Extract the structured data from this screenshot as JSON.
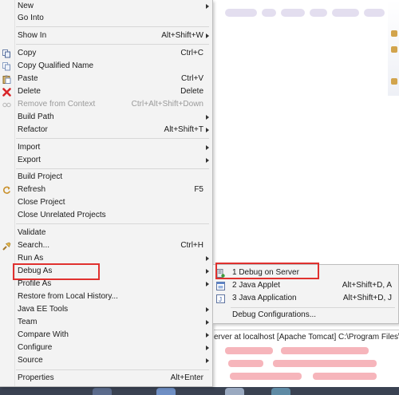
{
  "context_menu": {
    "items": [
      {
        "label": "New",
        "shortcut": "",
        "submenu": true,
        "icon": ""
      },
      {
        "label": "Go Into",
        "shortcut": "",
        "submenu": false,
        "icon": ""
      },
      {
        "label": "Show In",
        "shortcut": "Alt+Shift+W",
        "submenu": true,
        "icon": ""
      },
      {
        "label": "Copy",
        "shortcut": "Ctrl+C",
        "submenu": false,
        "icon": "copy-icon"
      },
      {
        "label": "Copy Qualified Name",
        "shortcut": "",
        "submenu": false,
        "icon": "copy-qualified-name-icon"
      },
      {
        "label": "Paste",
        "shortcut": "Ctrl+V",
        "submenu": false,
        "icon": "paste-icon"
      },
      {
        "label": "Delete",
        "shortcut": "Delete",
        "submenu": false,
        "icon": "delete-icon"
      },
      {
        "label": "Remove from Context",
        "shortcut": "Ctrl+Alt+Shift+Down",
        "submenu": false,
        "icon": "remove-from-context-icon",
        "disabled": true
      },
      {
        "label": "Build Path",
        "shortcut": "",
        "submenu": true,
        "icon": ""
      },
      {
        "label": "Refactor",
        "shortcut": "Alt+Shift+T",
        "submenu": true,
        "icon": ""
      },
      {
        "label": "Import",
        "shortcut": "",
        "submenu": true,
        "icon": ""
      },
      {
        "label": "Export",
        "shortcut": "",
        "submenu": true,
        "icon": ""
      },
      {
        "label": "Build Project",
        "shortcut": "",
        "submenu": false,
        "icon": ""
      },
      {
        "label": "Refresh",
        "shortcut": "F5",
        "submenu": false,
        "icon": "refresh-icon"
      },
      {
        "label": "Close Project",
        "shortcut": "",
        "submenu": false,
        "icon": ""
      },
      {
        "label": "Close Unrelated Projects",
        "shortcut": "",
        "submenu": false,
        "icon": ""
      },
      {
        "label": "Validate",
        "shortcut": "",
        "submenu": false,
        "icon": ""
      },
      {
        "label": "Search...",
        "shortcut": "Ctrl+H",
        "submenu": false,
        "icon": "search-icon"
      },
      {
        "label": "Run As",
        "shortcut": "",
        "submenu": true,
        "icon": ""
      },
      {
        "label": "Debug As",
        "shortcut": "",
        "submenu": true,
        "icon": ""
      },
      {
        "label": "Profile As",
        "shortcut": "",
        "submenu": true,
        "icon": ""
      },
      {
        "label": "Restore from Local History...",
        "shortcut": "",
        "submenu": false,
        "icon": ""
      },
      {
        "label": "Java EE Tools",
        "shortcut": "",
        "submenu": true,
        "icon": ""
      },
      {
        "label": "Team",
        "shortcut": "",
        "submenu": true,
        "icon": ""
      },
      {
        "label": "Compare With",
        "shortcut": "",
        "submenu": true,
        "icon": ""
      },
      {
        "label": "Configure",
        "shortcut": "",
        "submenu": true,
        "icon": ""
      },
      {
        "label": "Source",
        "shortcut": "",
        "submenu": true,
        "icon": ""
      },
      {
        "label": "Properties",
        "shortcut": "Alt+Enter",
        "submenu": false,
        "icon": ""
      }
    ]
  },
  "debug_submenu": {
    "items": [
      {
        "label": "1 Debug on Server",
        "shortcut": "",
        "icon": "debug-on-server-icon"
      },
      {
        "label": "2 Java Applet",
        "shortcut": "Alt+Shift+D, A",
        "icon": "java-applet-icon"
      },
      {
        "label": "3 Java Application",
        "shortcut": "Alt+Shift+D, J",
        "icon": "java-application-icon"
      },
      {
        "label": "Debug Configurations...",
        "shortcut": "",
        "icon": ""
      }
    ]
  },
  "console": {
    "line": "erver at localhost [Apache Tomcat] C:\\Program Files\\Ja"
  },
  "colors": {
    "highlight_border": "#e0312f",
    "menu_background": "#f3f3f3"
  }
}
